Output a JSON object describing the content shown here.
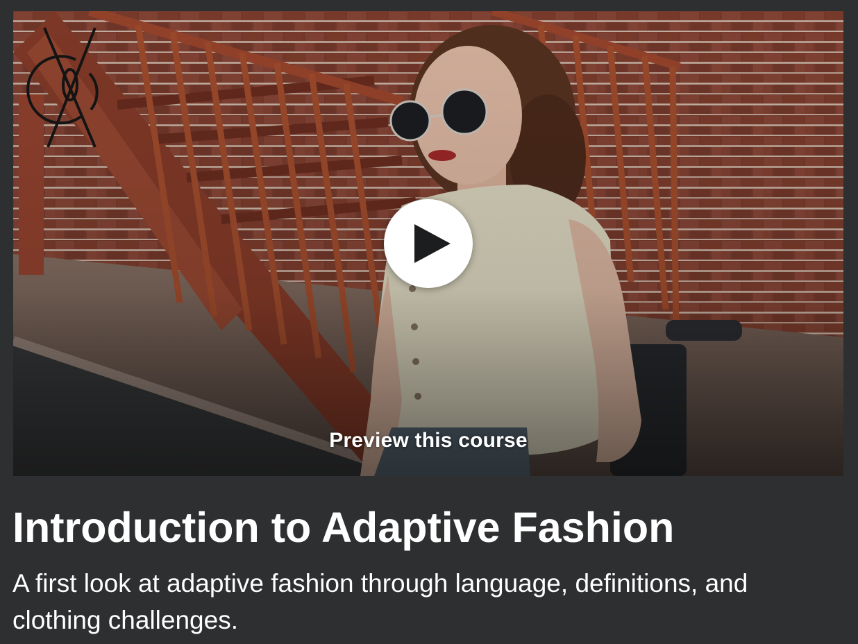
{
  "preview": {
    "image_alt": "course preview image",
    "play_icon": "play-icon",
    "logo_icon": "brand-monogram-logo",
    "label": "Preview this course"
  },
  "course": {
    "title": "Introduction to Adaptive Fashion",
    "headline": "A first look at adaptive fashion through language, definitions, and clothing challenges."
  },
  "colors": {
    "background": "#2d2f31",
    "text": "#ffffff",
    "play_button": "#ffffff",
    "play_glyph": "#1c1d1f"
  }
}
